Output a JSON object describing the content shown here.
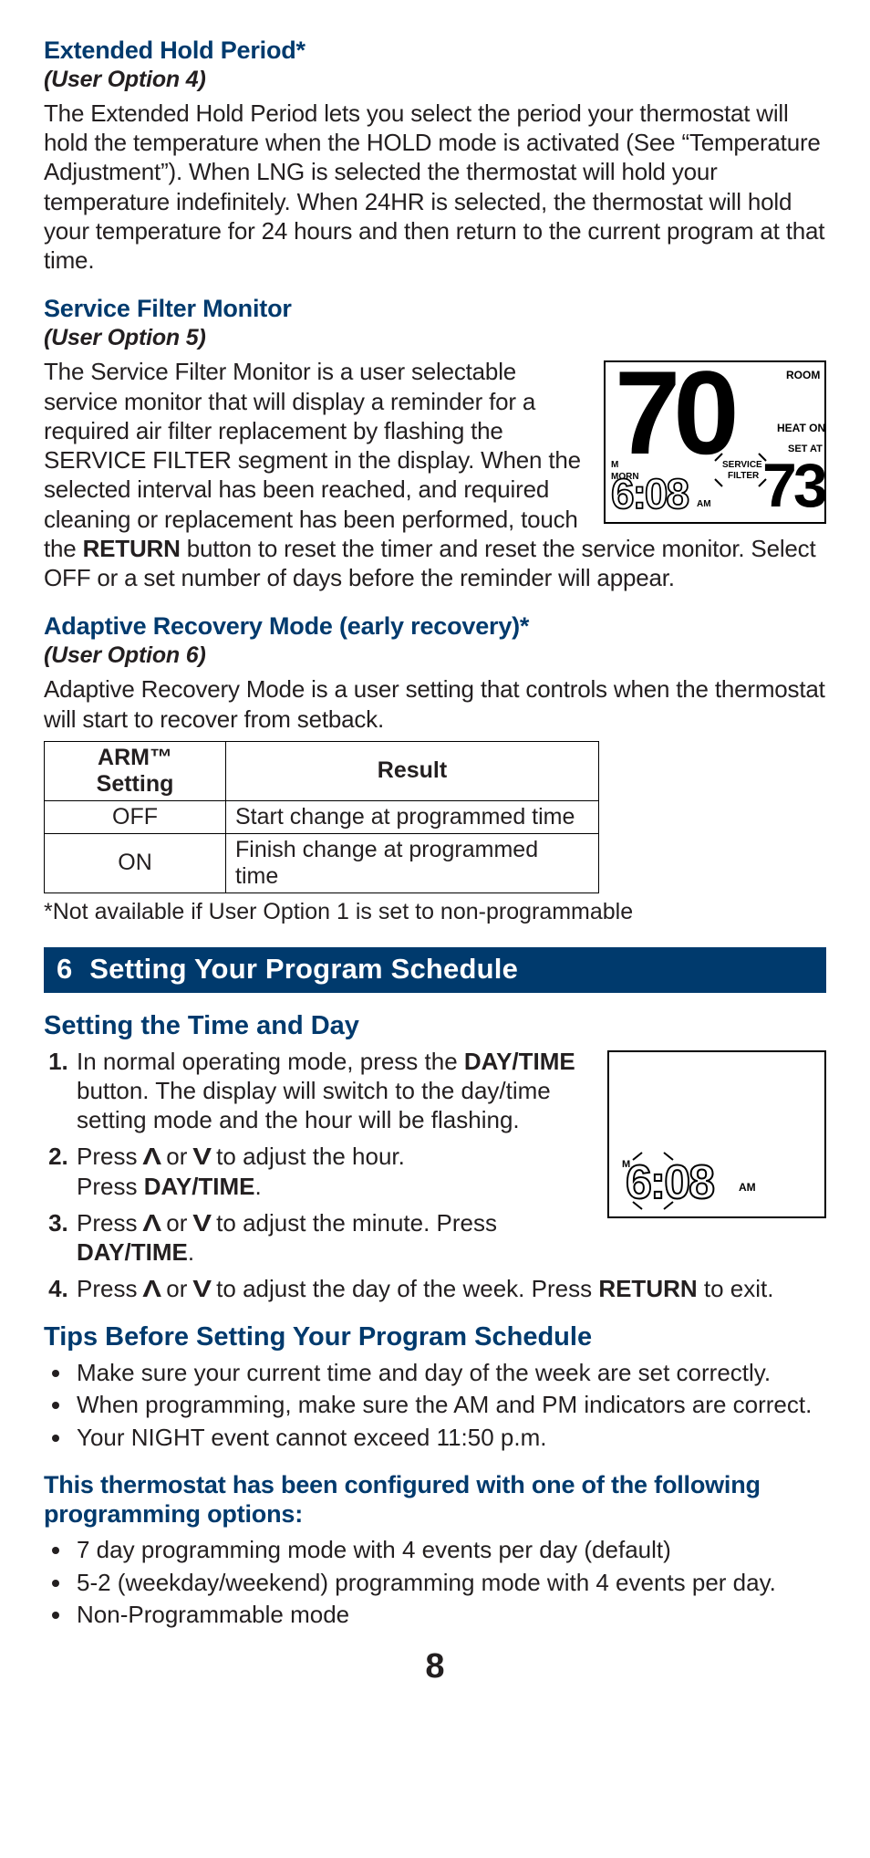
{
  "sec1": {
    "title": "Extended Hold Period*",
    "option": "(User Option 4)",
    "body": "The Extended Hold Period lets you select the period your thermostat will hold the temperature when the HOLD mode is activated (See “Temperature Adjustment”). When LNG is selected the thermostat will hold your temperature indefinitely.  When 24HR is selected, the thermostat will hold your temperature for 24 hours and then return to the current program at that time."
  },
  "sec2": {
    "title": "Service Filter Monitor",
    "option": "(User Option 5)",
    "body_pre": "The Service Filter Monitor is a user selectable service monitor that will display a reminder for a required air filter replacement by flashing the SERVICE FILTER segment in the display. When the selected interval has been reached, and required cleaning or replacement has been performed, touch the ",
    "body_bold": "RETURN",
    "body_post": " button to reset the timer and reset the service monitor. Select OFF or a set number of days before the reminder will appear.",
    "display": {
      "temp": "70",
      "room": "ROOM",
      "heat_on": "HEAT ON",
      "set_at": "SET AT",
      "setpoint": "73",
      "service": "SERVICE",
      "filter": "FILTER",
      "m": "M",
      "morn": "MORN",
      "time": "6:08",
      "am": "AM"
    }
  },
  "sec3": {
    "title": "Adaptive Recovery Mode (early recovery)*",
    "option": "(User Option 6)",
    "body": "Adaptive Recovery Mode is a user setting that controls when the thermostat will start to recover from setback.",
    "table": {
      "h1": "ARM™ Setting",
      "h2": "Result",
      "rows": [
        {
          "setting": "OFF",
          "result": "Start change at programmed time"
        },
        {
          "setting": "ON",
          "result": "Finish change at programmed time"
        }
      ]
    },
    "footnote": "*Not available if User Option 1 is set to non-programmable"
  },
  "banner": {
    "num": "6",
    "title": "Setting Your Program Schedule"
  },
  "time_day": {
    "heading": "Setting the Time and Day",
    "s1_pre": "In normal operating mode, press the ",
    "s1_bold": "DAY/TIME",
    "s1_post": " button. The display will switch to the day/time setting mode and the hour will be flashing.",
    "s2_pre": "Press ",
    "s2_mid": " or ",
    "s2_post1": " to adjust the hour.",
    "s2_line2_pre": "Press ",
    "s2_line2_bold": "DAY/TIME",
    "s2_line2_post": ".",
    "s3_pre": "Press ",
    "s3_mid": " or ",
    "s3_post1": " to adjust the minute. Press ",
    "s3_bold": "DAY/TIME",
    "s3_post2": ".",
    "s4_pre": "Press ",
    "s4_mid": " or ",
    "s4_post1": " to adjust the day of the week. Press ",
    "s4_bold": "RETURN",
    "s4_post2": " to exit.",
    "display": {
      "m": "M",
      "time": "6:08",
      "am": "AM"
    }
  },
  "tips": {
    "heading": "Tips Before Setting Your Program Schedule",
    "items": [
      "Make sure your current time and day of the week are set correctly.",
      "When programming, make sure the AM and PM indicators are correct.",
      "Your NIGHT event cannot exceed 11:50 p.m."
    ]
  },
  "config": {
    "heading": "This thermostat has been configured with one of the following programming options:",
    "items": [
      "7 day programming mode with 4 events per day (default)",
      "5-2 (weekday/weekend) programming mode with 4 events per day.",
      "Non-Programmable mode"
    ]
  },
  "page": "8",
  "icons": {
    "up": "Λ",
    "down": "V"
  }
}
